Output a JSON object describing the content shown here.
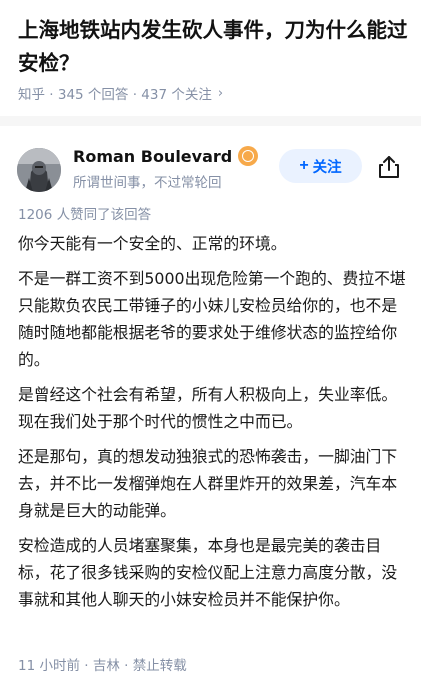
{
  "question": {
    "title": "上海地铁站内发生砍人事件，刀为什么能过安检？",
    "meta": "知乎 · 345 个回答 · 437 个关注",
    "chevron_icon": "chevron-right-icon"
  },
  "answer": {
    "author_name": "Roman Boulevard",
    "author_bio": "所谓世间事，不过常轮回",
    "badge_icon": "certified-badge-icon",
    "follow_label": "关注",
    "share_icon": "share-icon",
    "voters_text": "1206 人赞同了该回答",
    "paragraphs": [
      "你今天能有一个安全的、正常的环境。",
      "不是一群工资不到5000出现危险第一个跑的、费拉不堪只能欺负农民工带锤子的小妹儿安检员给你的，也不是随时随地都能根据老爷的要求处于维修状态的监控给你的。",
      "是曾经这个社会有希望，所有人积极向上，失业率低。现在我们处于那个时代的惯性之中而已。",
      "还是那句，真的想发动独狼式的恐怖袭击，一脚油门下去，并不比一发榴弹炮在人群里炸开的效果差，汽车本身就是巨大的动能弹。",
      "安检造成的人员堵塞聚集，本身也是最完美的袭击目标，花了很多钱采购的安检仪配上注意力高度分散，没事就和其他人聊天的小妹安检员并不能保护你。"
    ],
    "footer": "11 小时前 · 吉林 · 禁止转载"
  },
  "colors": {
    "accent": "#0066ff",
    "follow_bg": "#eaf2ff",
    "muted": "#8590a6",
    "badge": "#f7a94a"
  }
}
